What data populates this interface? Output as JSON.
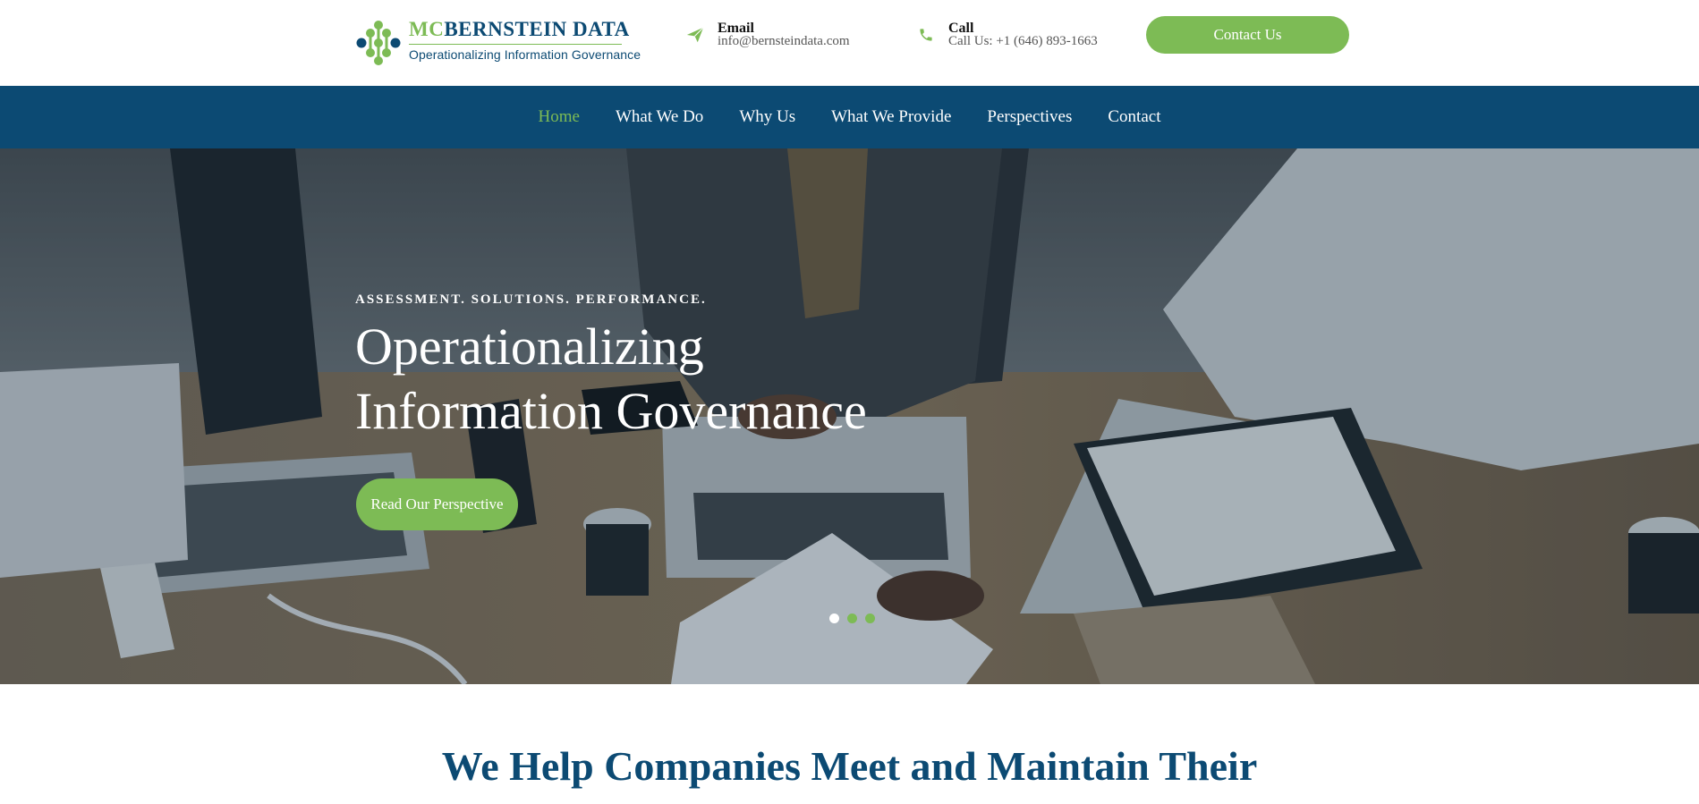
{
  "header": {
    "brand": {
      "prefix": "MC",
      "name": "BERNSTEIN DATA",
      "tagline": "Operationalizing Information Governance"
    },
    "email": {
      "label": "Email",
      "value": "info@bernsteindata.com",
      "icon": "paper-plane-icon"
    },
    "call": {
      "label": "Call",
      "value": "Call Us: +1 (646) 893-1663",
      "icon": "phone-icon"
    },
    "contact_button": "Contact Us"
  },
  "nav": {
    "items": [
      {
        "label": "Home",
        "active": true
      },
      {
        "label": "What We Do",
        "active": false
      },
      {
        "label": "Why Us",
        "active": false
      },
      {
        "label": "What We Provide",
        "active": false
      },
      {
        "label": "Perspectives",
        "active": false
      },
      {
        "label": "Contact",
        "active": false
      }
    ]
  },
  "hero": {
    "kicker": "ASSESSMENT. SOLUTIONS. PERFORMANCE.",
    "title_line1": "Operationalizing",
    "title_line2": "Information Governance",
    "cta": "Read Our Perspective",
    "slides": 3,
    "active_slide": 1
  },
  "intro": {
    "heading": "We Help Companies Meet and Maintain Their"
  },
  "colors": {
    "navy": "#0c4a73",
    "green": "#7dbb55",
    "white": "#ffffff"
  }
}
